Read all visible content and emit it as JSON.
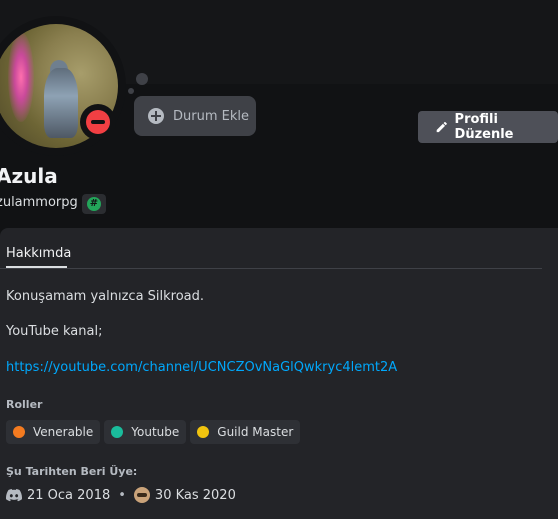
{
  "profile": {
    "display_name": "Azula",
    "username": "zulammorpg",
    "badge_symbol": "#",
    "status_button_label": "Durum Ekle",
    "edit_profile_label": "Profili Düzenle"
  },
  "tabs": {
    "about": "Hakkımda"
  },
  "bio": {
    "line1": "Konuşamam yalnızca Silkroad.",
    "line2": "YouTube kanal;",
    "link": "https://youtube.com/channel/UCNCZOvNaGlQwkryc4lemt2A"
  },
  "roles_section": {
    "title": "Roller",
    "roles": [
      {
        "name": "Venerable",
        "color": "#f47b20"
      },
      {
        "name": "Youtube",
        "color": "#1abc9c"
      },
      {
        "name": "Guild Master",
        "color": "#f1c40f"
      }
    ]
  },
  "member_since": {
    "title": "Şu Tarihten Beri Üye:",
    "discord_date": "21 Oca 2018",
    "separator": "•",
    "server_date": "30 Kas 2020"
  },
  "colors": {
    "accent_link": "#00a8fc",
    "dnd_status": "#f23f43",
    "badge_green": "#23a55a"
  }
}
